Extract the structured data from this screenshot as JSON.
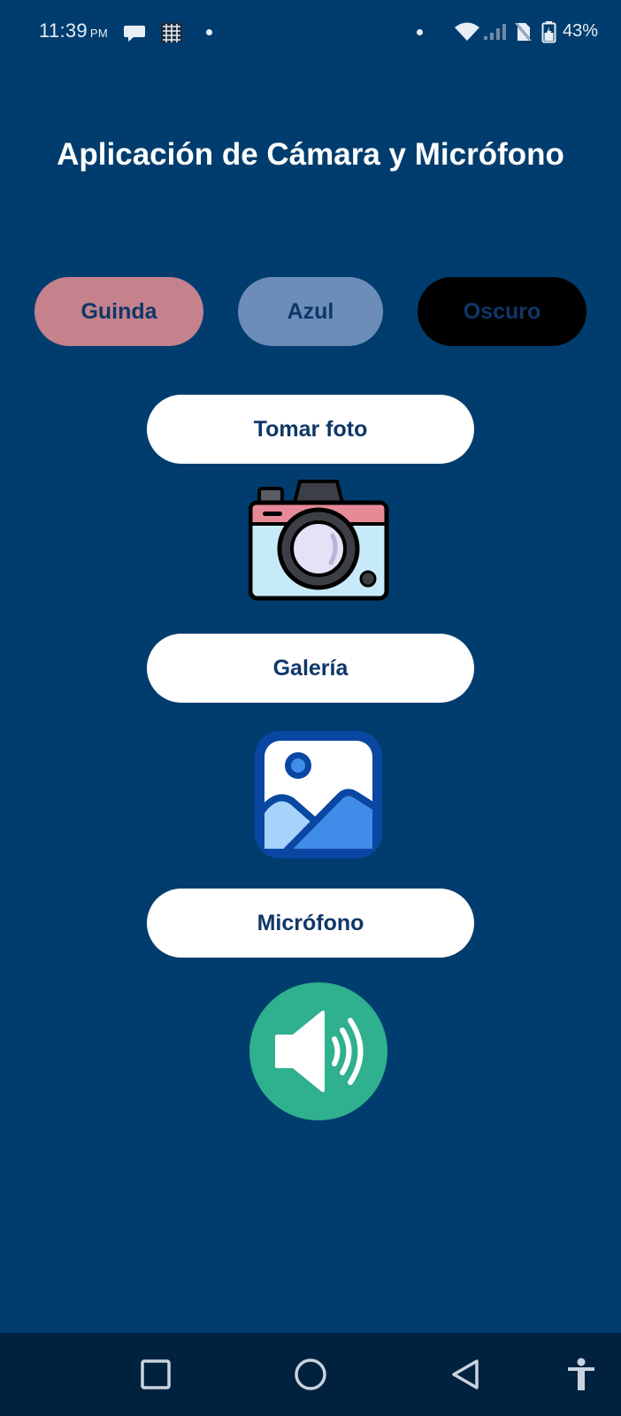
{
  "status_bar": {
    "time": "11:39",
    "ampm": "PM",
    "battery": "43%"
  },
  "app": {
    "title": "Aplicación de Cámara y Micrófono"
  },
  "theme_buttons": {
    "guinda": "Guinda",
    "azul": "Azul",
    "oscuro": "Oscuro"
  },
  "actions": {
    "camera": "Tomar foto",
    "gallery": "Galería",
    "microphone": "Micrófono"
  },
  "icons": {
    "camera": "camera-icon",
    "gallery": "gallery-icon",
    "speaker": "speaker-icon"
  },
  "colors": {
    "background": "#003D6E",
    "guinda": "#C5818C",
    "azul": "#6B8DB8",
    "oscuro": "#000000",
    "button_text": "#0F3768",
    "speaker_circle": "#2FB08E",
    "nav_bar": "#00223F"
  }
}
